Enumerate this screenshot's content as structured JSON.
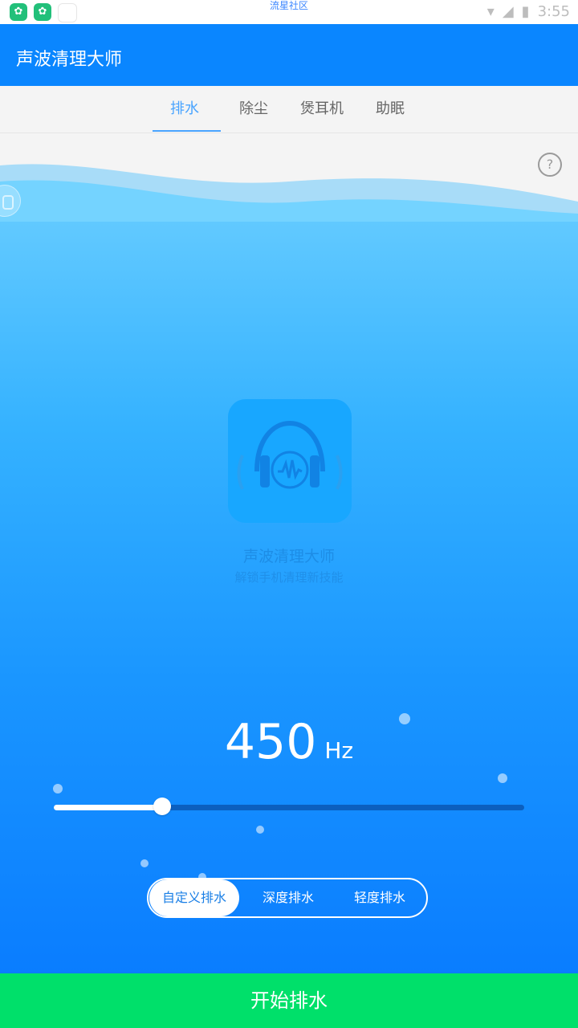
{
  "status_bar": {
    "center_text": "流星社区",
    "time": "3:55",
    "left_icons": [
      "app-icon",
      "app-icon",
      "blank-icon"
    ],
    "right_icons": [
      "wifi-icon",
      "signal-icon",
      "battery-icon"
    ]
  },
  "app_bar": {
    "title": "声波清理大师"
  },
  "tabs": [
    {
      "label": "排水",
      "active": true
    },
    {
      "label": "除尘",
      "active": false
    },
    {
      "label": "煲耳机",
      "active": false
    },
    {
      "label": "助眠",
      "active": false
    }
  ],
  "help": {
    "glyph": "?"
  },
  "logo": {
    "title": "声波清理大师",
    "subtitle": "解锁手机清理新技能"
  },
  "frequency": {
    "value": "450",
    "unit": "Hz",
    "slider_fraction": 0.23
  },
  "modes": [
    {
      "label": "自定义排水",
      "active": true
    },
    {
      "label": "深度排水",
      "active": false
    },
    {
      "label": "轻度排水",
      "active": false
    }
  ],
  "start_button": {
    "label": "开始排水"
  },
  "colors": {
    "primary": "#0a86ff",
    "tab_active": "#49a4ff",
    "start_button": "#00e06a"
  }
}
